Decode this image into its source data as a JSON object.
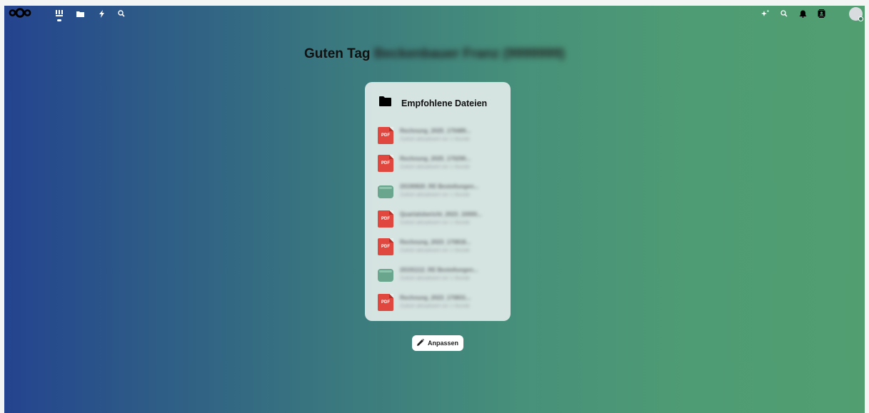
{
  "greeting": {
    "prefix": "Guten Tag ",
    "user_name": "Beckenbauer Franz (9999999)"
  },
  "nav": {
    "apps": [
      "dashboard-icon",
      "files-icon",
      "activity-icon",
      "search-icon"
    ],
    "right": [
      "assistant-icon",
      "unified-search-icon",
      "notifications-icon",
      "contacts-icon",
      "user-avatar"
    ]
  },
  "widget": {
    "title": "Empfohlene Dateien",
    "files": [
      {
        "type": "pdf",
        "badge": "PDF",
        "name": "Rechnung_2025_170489...",
        "sub": "Zuletzt aktualisiert vor 1 Stunde"
      },
      {
        "type": "pdf",
        "badge": "PDF",
        "name": "Rechnung_2025_170290...",
        "sub": "Zuletzt aktualisiert vor 1 Stunde"
      },
      {
        "type": "archive",
        "badge": "",
        "name": "20190820_RE Bestellungen...",
        "sub": "Zuletzt aktualisiert vor 1 Stunde"
      },
      {
        "type": "pdf",
        "badge": "PDF",
        "name": "Quartalsbericht_2023_10000...",
        "sub": "Zuletzt aktualisiert vor 1 Stunde"
      },
      {
        "type": "pdf",
        "badge": "PDF",
        "name": "Rechnung_2023_170818...",
        "sub": "Zuletzt aktualisiert vor 1 Stunde"
      },
      {
        "type": "archive",
        "badge": "",
        "name": "20191112_RE Bestellungen...",
        "sub": "Zuletzt aktualisiert vor 1 Stunde"
      },
      {
        "type": "pdf",
        "badge": "PDF",
        "name": "Rechnung_2023_170831...",
        "sub": "Zuletzt aktualisiert vor 1 Stunde"
      }
    ]
  },
  "customize_button": {
    "label": "Anpassen"
  },
  "colors": {
    "gradient_start": "#24448f",
    "gradient_end": "#519e71",
    "pdf": "#e0473f",
    "archive": "#6aa58e"
  }
}
